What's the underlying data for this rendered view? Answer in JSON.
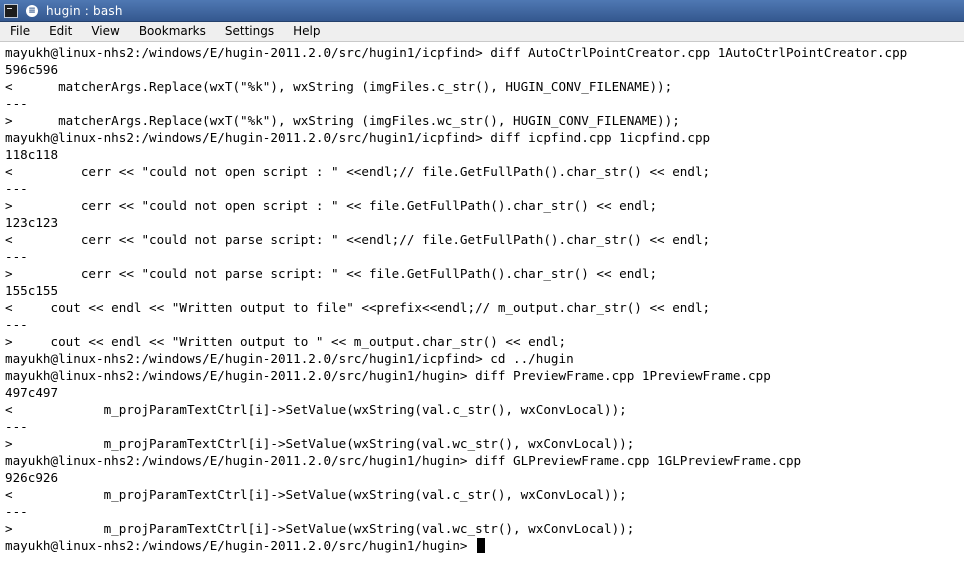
{
  "window": {
    "title": "hugin : bash",
    "menu_glyph": "≡"
  },
  "menubar": {
    "items": [
      "File",
      "Edit",
      "View",
      "Bookmarks",
      "Settings",
      "Help"
    ]
  },
  "terminal": {
    "lines": [
      "mayukh@linux-nhs2:/windows/E/hugin-2011.2.0/src/hugin1/icpfind> diff AutoCtrlPointCreator.cpp 1AutoCtrlPointCreator.cpp",
      "596c596",
      "<      matcherArgs.Replace(wxT(\"%k\"), wxString (imgFiles.c_str(), HUGIN_CONV_FILENAME));",
      "---",
      ">      matcherArgs.Replace(wxT(\"%k\"), wxString (imgFiles.wc_str(), HUGIN_CONV_FILENAME));",
      "mayukh@linux-nhs2:/windows/E/hugin-2011.2.0/src/hugin1/icpfind> diff icpfind.cpp 1icpfind.cpp",
      "118c118",
      "<         cerr << \"could not open script : \" <<endl;// file.GetFullPath().char_str() << endl;",
      "---",
      ">         cerr << \"could not open script : \" << file.GetFullPath().char_str() << endl;",
      "123c123",
      "<         cerr << \"could not parse script: \" <<endl;// file.GetFullPath().char_str() << endl;",
      "---",
      ">         cerr << \"could not parse script: \" << file.GetFullPath().char_str() << endl;",
      "155c155",
      "<     cout << endl << \"Written output to file\" <<prefix<<endl;// m_output.char_str() << endl;",
      "---",
      ">     cout << endl << \"Written output to \" << m_output.char_str() << endl;",
      "mayukh@linux-nhs2:/windows/E/hugin-2011.2.0/src/hugin1/icpfind> cd ../hugin",
      "mayukh@linux-nhs2:/windows/E/hugin-2011.2.0/src/hugin1/hugin> diff PreviewFrame.cpp 1PreviewFrame.cpp",
      "497c497",
      "<            m_projParamTextCtrl[i]->SetValue(wxString(val.c_str(), wxConvLocal));",
      "---",
      ">            m_projParamTextCtrl[i]->SetValue(wxString(val.wc_str(), wxConvLocal));",
      "mayukh@linux-nhs2:/windows/E/hugin-2011.2.0/src/hugin1/hugin> diff GLPreviewFrame.cpp 1GLPreviewFrame.cpp",
      "926c926",
      "<            m_projParamTextCtrl[i]->SetValue(wxString(val.c_str(), wxConvLocal));",
      "---",
      ">            m_projParamTextCtrl[i]->SetValue(wxString(val.wc_str(), wxConvLocal));"
    ],
    "prompt": "mayukh@linux-nhs2:/windows/E/hugin-2011.2.0/src/hugin1/hugin> "
  }
}
